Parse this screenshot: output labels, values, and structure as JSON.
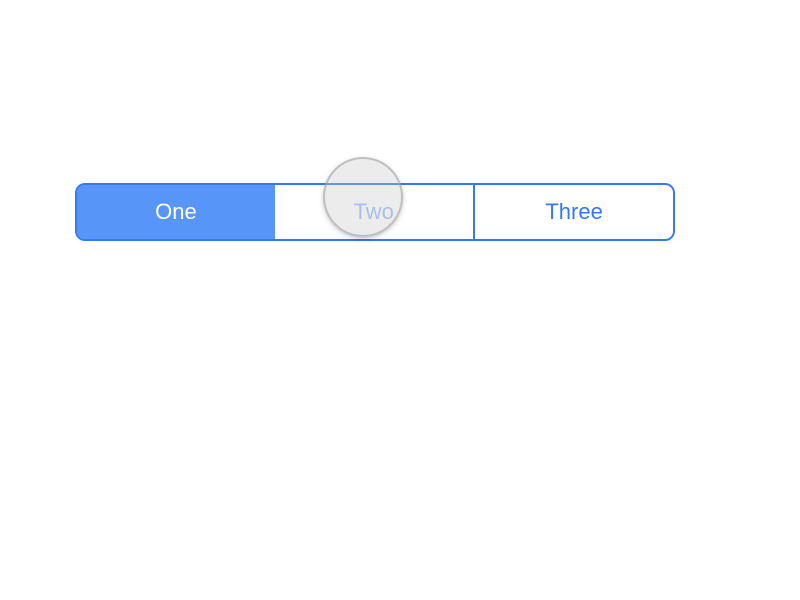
{
  "segmented_control": {
    "segments": [
      {
        "label": "One",
        "selected": true,
        "pressed": false
      },
      {
        "label": "Two",
        "selected": false,
        "pressed": true
      },
      {
        "label": "Three",
        "selected": false,
        "pressed": false
      }
    ]
  },
  "colors": {
    "primary": "#3478f6",
    "selected_bg": "#5795f9",
    "selected_text": "#ffffff",
    "background": "#ffffff"
  }
}
